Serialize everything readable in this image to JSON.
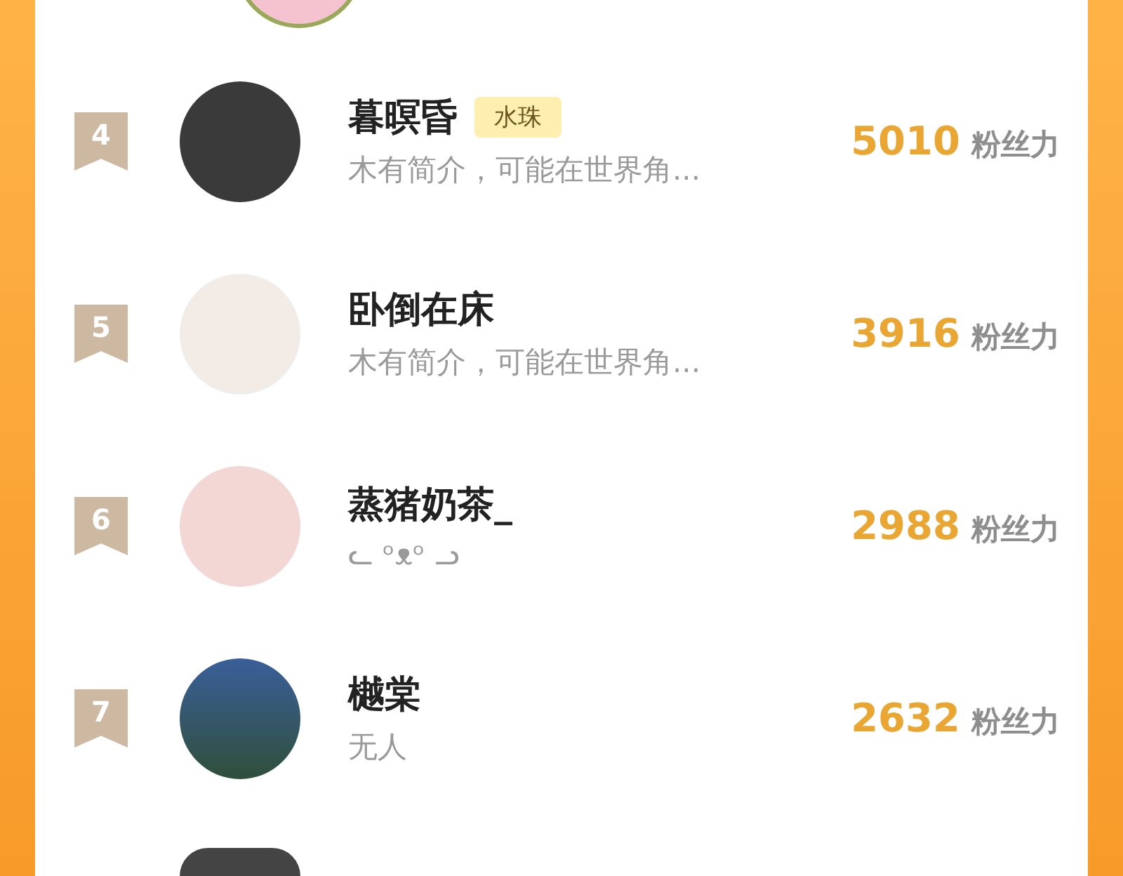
{
  "fans": [
    {
      "rank": "4",
      "name": "暮暝昏",
      "badge": "水珠",
      "bio": "木有简介，可能在世界角...",
      "score": "5010",
      "score_label": "粉丝力"
    },
    {
      "rank": "5",
      "name": "卧倒在床",
      "bio": "木有简介，可能在世界角...",
      "score": "3916",
      "score_label": "粉丝力"
    },
    {
      "rank": "6",
      "name": "蒸猪奶茶_",
      "bio": "ᓚ ᵒᴥᵒ ᓗ",
      "score": "2988",
      "score_label": "粉丝力"
    },
    {
      "rank": "7",
      "name": "樾棠",
      "bio": "无人",
      "score": "2632",
      "score_label": "粉丝力"
    }
  ]
}
